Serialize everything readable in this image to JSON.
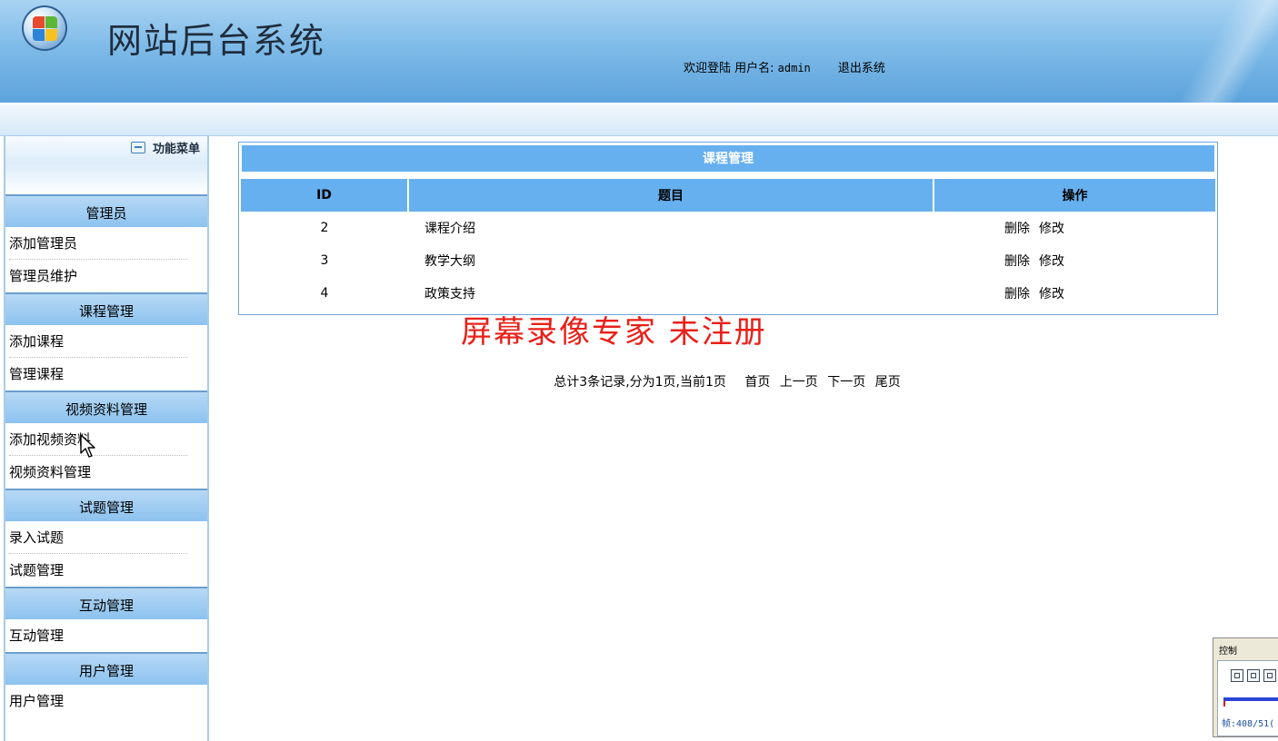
{
  "header": {
    "site_title": "网站后台系统",
    "welcome": "欢迎登陆 用户名:",
    "username": "admin",
    "logout": "退出系统"
  },
  "sidebar": {
    "title": "功能菜单",
    "groups": [
      {
        "label": "管理员",
        "items": [
          "添加管理员",
          "管理员维护"
        ]
      },
      {
        "label": "课程管理",
        "items": [
          "添加课程",
          "管理课程"
        ]
      },
      {
        "label": "视频资料管理",
        "items": [
          "添加视频资料",
          "视频资料管理"
        ]
      },
      {
        "label": "试题管理",
        "items": [
          "录入试题",
          "试题管理"
        ]
      },
      {
        "label": "互动管理",
        "items": [
          "互动管理"
        ]
      },
      {
        "label": "用户管理",
        "items": [
          "用户管理"
        ]
      }
    ]
  },
  "panel": {
    "title": "课程管理",
    "columns": [
      "ID",
      "题目",
      "操作"
    ],
    "rows": [
      {
        "id": "2",
        "title": "课程介绍",
        "delete": "删除",
        "edit": "修改"
      },
      {
        "id": "3",
        "title": "教学大纲",
        "delete": "删除",
        "edit": "修改"
      },
      {
        "id": "4",
        "title": "政策支持",
        "delete": "删除",
        "edit": "修改"
      }
    ]
  },
  "watermark": "屏幕录像专家  未注册",
  "pager": {
    "summary": "总计3条记录,分为1页,当前1页",
    "first": "首页",
    "prev": "上一页",
    "next": "下一页",
    "last": "尾页"
  },
  "control": {
    "title": "控制",
    "frame": "帧:408/51("
  },
  "colors": {
    "header_blue": "#7fbbe8",
    "table_header": "#66b0ef",
    "watermark_red": "#e8201a"
  }
}
